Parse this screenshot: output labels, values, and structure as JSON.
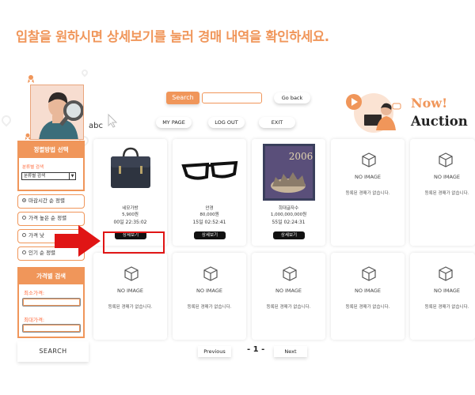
{
  "headline": "입찰을 원하시면 상세보기를 눌러 경매 내역을 확인하세요.",
  "user": {
    "name": "abc"
  },
  "topbar": {
    "search_label": "Search",
    "search_value": "",
    "go_back_label": "Go back",
    "my_page_label": "MY PAGE",
    "logout_label": "LOG OUT",
    "exit_label": "EXIT"
  },
  "logo": {
    "now": "Now!",
    "auction": "Auction"
  },
  "sidebar": {
    "sort_title": "정렬방법 선택",
    "sort_label": "분류별 검색",
    "sort_select_value": "분류별 검색",
    "options": [
      {
        "label": "마감시간 순 정렬",
        "checked": true
      },
      {
        "label": "가격 높은 순 정렬",
        "checked": false
      },
      {
        "label": "가격 낮",
        "checked": false
      },
      {
        "label": "인기 순 정렬",
        "checked": false
      }
    ],
    "price_title": "가격별 검색",
    "min_label": "최소가격:",
    "max_label": "최대가격:",
    "search_button": "SEARCH"
  },
  "products": [
    {
      "name": "네모가방",
      "price": "5,900원",
      "time": "00일 22:35:02",
      "button": "상세보기"
    },
    {
      "name": "안경",
      "price": "80,000원",
      "time": "15일 02:52:41",
      "button": "상세보기"
    },
    {
      "name": "희대글자수",
      "price": "1,000,000,000원",
      "time": "55일 02:24:31",
      "button": "상세보기"
    }
  ],
  "empty_card": {
    "title": "NO IMAGE",
    "subtitle": "등록된 경매가 없습니다."
  },
  "pagination": {
    "previous": "Previous",
    "current": "- 1 -",
    "next": "Next"
  },
  "colors": {
    "accent": "#f0965a",
    "highlight": "#e01515"
  }
}
